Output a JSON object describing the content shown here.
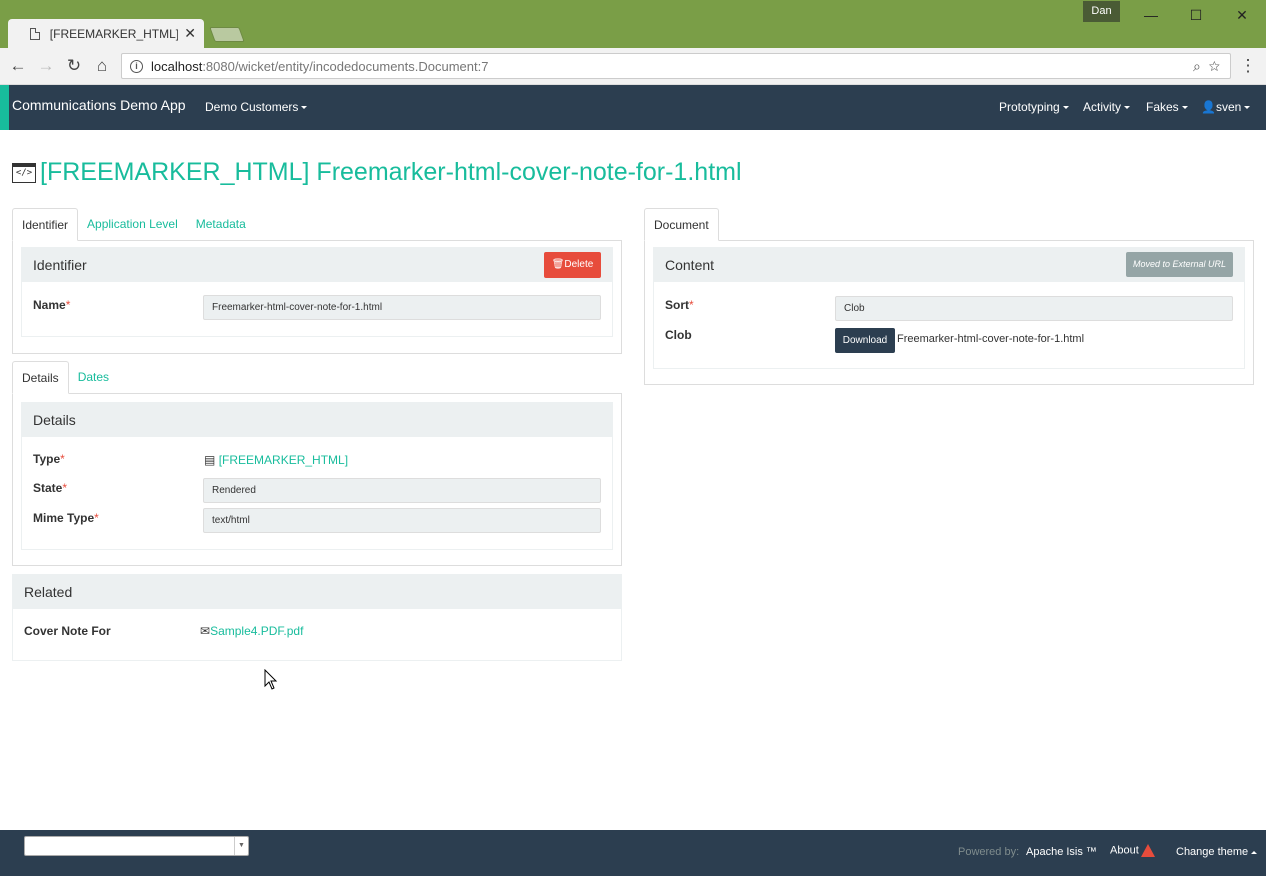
{
  "browser": {
    "tab_title": "[FREEMARKER_HTML] Freemarker-html-cover-note-for-1.html",
    "user_badge": "Dan",
    "url_host": "localhost",
    "url_rest": ":8080/wicket/entity/incodedocuments.Document:7"
  },
  "navbar": {
    "brand": "Communications Demo App",
    "menu_demo_customers": "Demo Customers",
    "menu_prototyping": "Prototyping",
    "menu_activity": "Activity",
    "menu_fakes": "Fakes",
    "menu_user": "sven"
  },
  "page": {
    "title": "[FREEMARKER_HTML] Freemarker-html-cover-note-for-1.html"
  },
  "left_tabs": [
    "Identifier",
    "Application Level",
    "Metadata"
  ],
  "identifier_panel": {
    "heading": "Identifier",
    "delete_label": "Delete",
    "name_label": "Name",
    "name_value": "Freemarker-html-cover-note-for-1.html"
  },
  "details_tabs": [
    "Details",
    "Dates"
  ],
  "details_panel": {
    "heading": "Details",
    "type_label": "Type",
    "type_value": "[FREEMARKER_HTML]",
    "state_label": "State",
    "state_value": "Rendered",
    "mime_label": "Mime Type",
    "mime_value": "text/html"
  },
  "related_panel": {
    "heading": "Related",
    "cover_label": "Cover Note For",
    "cover_value": "Sample4.PDF.pdf"
  },
  "right_tabs": [
    "Document"
  ],
  "content_panel": {
    "heading": "Content",
    "moved_label": "Moved to External URL",
    "sort_label": "Sort",
    "sort_value": "Clob",
    "clob_label": "Clob",
    "download_label": "Download",
    "clob_filename": "Freemarker-html-cover-note-for-1.html"
  },
  "footer": {
    "powered_by": "Powered by:",
    "apache_isis": "Apache Isis ™",
    "about": "About",
    "change_theme": "Change theme"
  },
  "colors": {
    "accent": "#18bc9c",
    "navbar": "#2c3e50",
    "chrome": "#7a9e47",
    "danger": "#e74c3c"
  }
}
